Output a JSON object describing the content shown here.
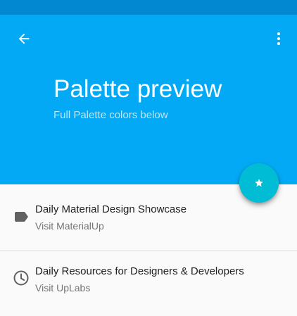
{
  "header": {
    "title": "Palette preview",
    "subtitle": "Full Palette colors below",
    "back_icon": "arrow-back-icon",
    "menu_icon": "more-vert-icon"
  },
  "fab": {
    "icon": "star-icon"
  },
  "list": {
    "items": [
      {
        "title": "Daily Material Design Showcase",
        "subtitle": "Visit MaterialUp",
        "icon": "label-icon"
      },
      {
        "title": "Daily Resources for Designers & Developers",
        "subtitle": "Visit UpLabs",
        "icon": "clock-icon"
      }
    ]
  },
  "colors": {
    "status_bar": "#0288d1",
    "primary": "#03a9f4",
    "accent": "#00bcd4",
    "background": "#fafafa"
  }
}
